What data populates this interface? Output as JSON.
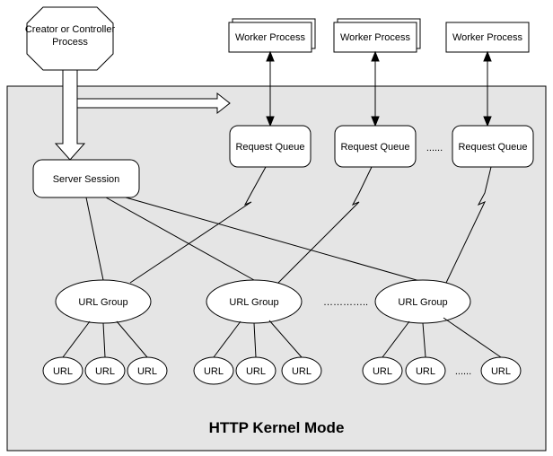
{
  "diagram": {
    "title": "HTTP Kernel Mode",
    "creator": "Creator or Controller\nProcess",
    "worker1": "Worker Process",
    "worker2": "Worker Process",
    "worker3": "Worker Process",
    "rq1": "Request Queue",
    "rq2": "Request Queue",
    "rq3": "Request Queue",
    "rq_ellipsis": "......",
    "server_session": "Server Session",
    "urlgroup1": "URL Group",
    "urlgroup2": "URL Group",
    "urlgroup3": "URL Group",
    "urlgroup_ellipsis": "…………..",
    "url": "URL",
    "url_ellipsis": "......"
  },
  "chart_data": {
    "type": "diagram",
    "title": "HTTP Kernel Mode",
    "nodes": [
      {
        "id": "creator",
        "label": "Creator or Controller Process",
        "shape": "octagon",
        "region": "user"
      },
      {
        "id": "worker1",
        "label": "Worker Process",
        "shape": "rect-stacked",
        "region": "user"
      },
      {
        "id": "worker2",
        "label": "Worker Process",
        "shape": "rect-stacked",
        "region": "user"
      },
      {
        "id": "worker3",
        "label": "Worker Process",
        "shape": "rect",
        "region": "user"
      },
      {
        "id": "rq1",
        "label": "Request Queue",
        "shape": "rounded-rect",
        "region": "kernel"
      },
      {
        "id": "rq2",
        "label": "Request Queue",
        "shape": "rounded-rect",
        "region": "kernel"
      },
      {
        "id": "rq3",
        "label": "Request Queue",
        "shape": "rounded-rect",
        "region": "kernel"
      },
      {
        "id": "session",
        "label": "Server Session",
        "shape": "rounded-rect",
        "region": "kernel"
      },
      {
        "id": "ug1",
        "label": "URL Group",
        "shape": "ellipse",
        "region": "kernel"
      },
      {
        "id": "ug2",
        "label": "URL Group",
        "shape": "ellipse",
        "region": "kernel"
      },
      {
        "id": "ug3",
        "label": "URL Group",
        "shape": "ellipse",
        "region": "kernel"
      },
      {
        "id": "url1a",
        "label": "URL",
        "shape": "ellipse",
        "region": "kernel"
      },
      {
        "id": "url1b",
        "label": "URL",
        "shape": "ellipse",
        "region": "kernel"
      },
      {
        "id": "url1c",
        "label": "URL",
        "shape": "ellipse",
        "region": "kernel"
      },
      {
        "id": "url2a",
        "label": "URL",
        "shape": "ellipse",
        "region": "kernel"
      },
      {
        "id": "url2b",
        "label": "URL",
        "shape": "ellipse",
        "region": "kernel"
      },
      {
        "id": "url2c",
        "label": "URL",
        "shape": "ellipse",
        "region": "kernel"
      },
      {
        "id": "url3a",
        "label": "URL",
        "shape": "ellipse",
        "region": "kernel"
      },
      {
        "id": "url3b",
        "label": "URL",
        "shape": "ellipse",
        "region": "kernel"
      },
      {
        "id": "url3c",
        "label": "URL",
        "shape": "ellipse",
        "region": "kernel"
      }
    ],
    "edges": [
      {
        "from": "creator",
        "to": "session",
        "style": "thick-open-arrow"
      },
      {
        "from": "creator",
        "to": "rq1",
        "style": "thick-open-arrow"
      },
      {
        "from": "worker1",
        "to": "rq1",
        "style": "bidirectional"
      },
      {
        "from": "worker2",
        "to": "rq2",
        "style": "bidirectional"
      },
      {
        "from": "worker3",
        "to": "rq3",
        "style": "bidirectional"
      },
      {
        "from": "session",
        "to": "ug1",
        "style": "line"
      },
      {
        "from": "session",
        "to": "ug2",
        "style": "line"
      },
      {
        "from": "session",
        "to": "ug3",
        "style": "line"
      },
      {
        "from": "ug1",
        "to": "rq1",
        "style": "zigzag"
      },
      {
        "from": "ug2",
        "to": "rq2",
        "style": "zigzag"
      },
      {
        "from": "ug3",
        "to": "rq3",
        "style": "zigzag"
      },
      {
        "from": "ug1",
        "to": "url1a",
        "style": "line"
      },
      {
        "from": "ug1",
        "to": "url1b",
        "style": "line"
      },
      {
        "from": "ug1",
        "to": "url1c",
        "style": "line"
      },
      {
        "from": "ug2",
        "to": "url2a",
        "style": "line"
      },
      {
        "from": "ug2",
        "to": "url2b",
        "style": "line"
      },
      {
        "from": "ug2",
        "to": "url2c",
        "style": "line"
      },
      {
        "from": "ug3",
        "to": "url3a",
        "style": "line"
      },
      {
        "from": "ug3",
        "to": "url3b",
        "style": "line"
      },
      {
        "from": "ug3",
        "to": "url3c",
        "style": "line"
      }
    ],
    "regions": [
      {
        "id": "kernel",
        "label": "HTTP Kernel Mode",
        "fill": "#e5e5e5"
      }
    ]
  }
}
